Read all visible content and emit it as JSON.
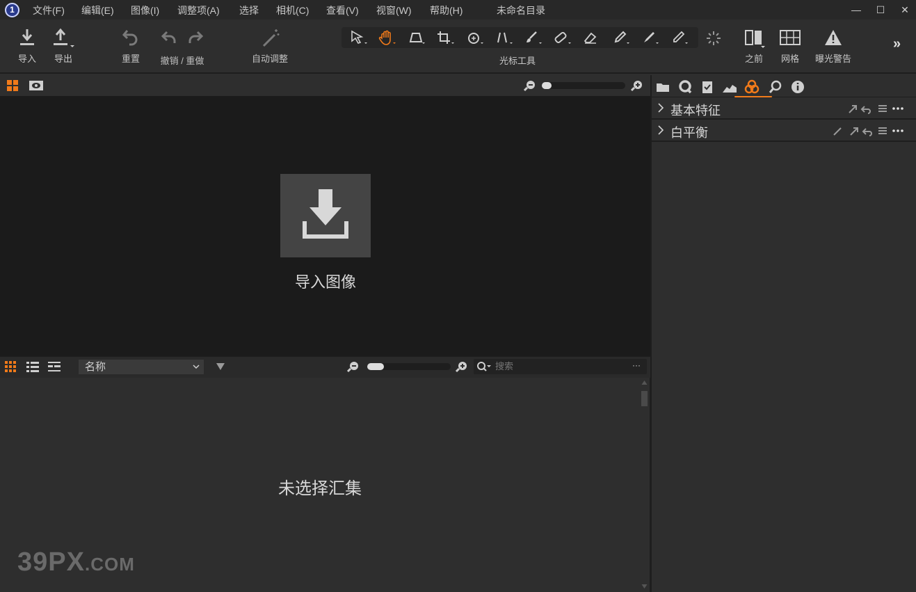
{
  "app": {
    "logo_glyph": "1",
    "window_title": "未命名目录"
  },
  "menu": {
    "items": [
      "文件(F)",
      "编辑(E)",
      "图像(I)",
      "调整项(A)",
      "选择",
      "相机(C)",
      "查看(V)",
      "视窗(W)",
      "帮助(H)"
    ]
  },
  "window_controls": {
    "minimize": "—",
    "maximize": "☐",
    "close": "✕"
  },
  "toolbar": {
    "import": "导入",
    "export": "导出",
    "reset": "重置",
    "undo_redo": "撤销 / 重做",
    "auto_adjust": "自动调整",
    "cursor_tools_label": "光标工具",
    "before": "之前",
    "grid": "网格",
    "exposure_warning": "曝光警告",
    "more": "»"
  },
  "viewer": {
    "import_images": "导入图像",
    "zoom_level": 0.12
  },
  "browser": {
    "sort_by": "名称",
    "search_placeholder": "搜索",
    "search_more": "···",
    "empty_message": "未选择汇集",
    "zoom_level": 0.2
  },
  "tools_panel": {
    "rows": [
      {
        "label": "基本特征"
      },
      {
        "label": "白平衡"
      }
    ]
  },
  "watermark": {
    "main": "39PX",
    "suffix": ".COM"
  },
  "colors": {
    "accent": "#f07a1a",
    "background": "#2e2e2e",
    "viewer": "#1b1b1b"
  }
}
